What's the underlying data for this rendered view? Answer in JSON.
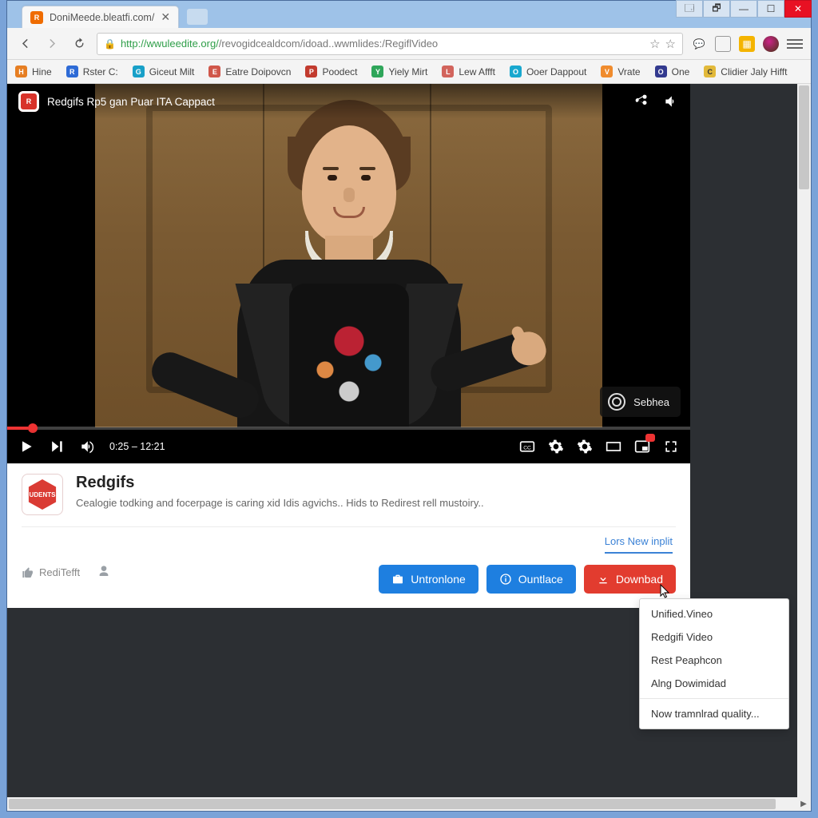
{
  "browser": {
    "tab_title": "DoniMeede.bleatfi.com/",
    "url_scheme": "http://",
    "url_host": "wwuleedite.org/",
    "url_path": "/revogidcealdcom/idoad..wwmlides:/RegiflVideo",
    "window_buttons": {
      "min": "—",
      "max": "❐",
      "restore": "🗗",
      "close": "✕"
    }
  },
  "bookmarks": [
    {
      "label": "Hine",
      "color": "#e67e22"
    },
    {
      "label": "Rster C:",
      "color": "#2e6bd6"
    },
    {
      "label": "Giceut Milt",
      "color": "#18a0c8"
    },
    {
      "label": "Eatre Doipovcn",
      "color": "#d0574a"
    },
    {
      "label": "Poodect",
      "color": "#c23b2e"
    },
    {
      "label": "Yiely Mirt",
      "color": "#2fa65a"
    },
    {
      "label": "Lew Affft",
      "color": "#d2645c"
    },
    {
      "label": "Ooer Dappout",
      "color": "#19a8cf"
    },
    {
      "label": "Vrate",
      "color": "#f08c2e"
    },
    {
      "label": "One",
      "color": "#333a8f"
    },
    {
      "label": "Clidier Jaly Hifft",
      "color": "#e2b93a"
    }
  ],
  "video": {
    "overlay_title": "Redgifs Rp5 gan Puar ITA Cappact",
    "time_current": "0:25",
    "time_total": "12:21",
    "watermark": "Sebhea"
  },
  "card": {
    "title": "Redgifs",
    "desc": "Cealogie todking and focerpage is caring xid Idis agvichs.. Hids to Redirest rell mustoiry..",
    "lots_link": "Lors New inplit",
    "like_label": "RediTefft",
    "channel_badge_text": "UDENTS"
  },
  "buttons": {
    "untronlone": "Untronlone",
    "ountlace": "Ountlace",
    "download": "Downbad"
  },
  "menu": {
    "items": [
      "Unified.Vineo",
      "Redgifi Video",
      "Rest Peaphcon",
      "Alng Dowimidad"
    ],
    "footer": "Now tramnlrad quality..."
  }
}
